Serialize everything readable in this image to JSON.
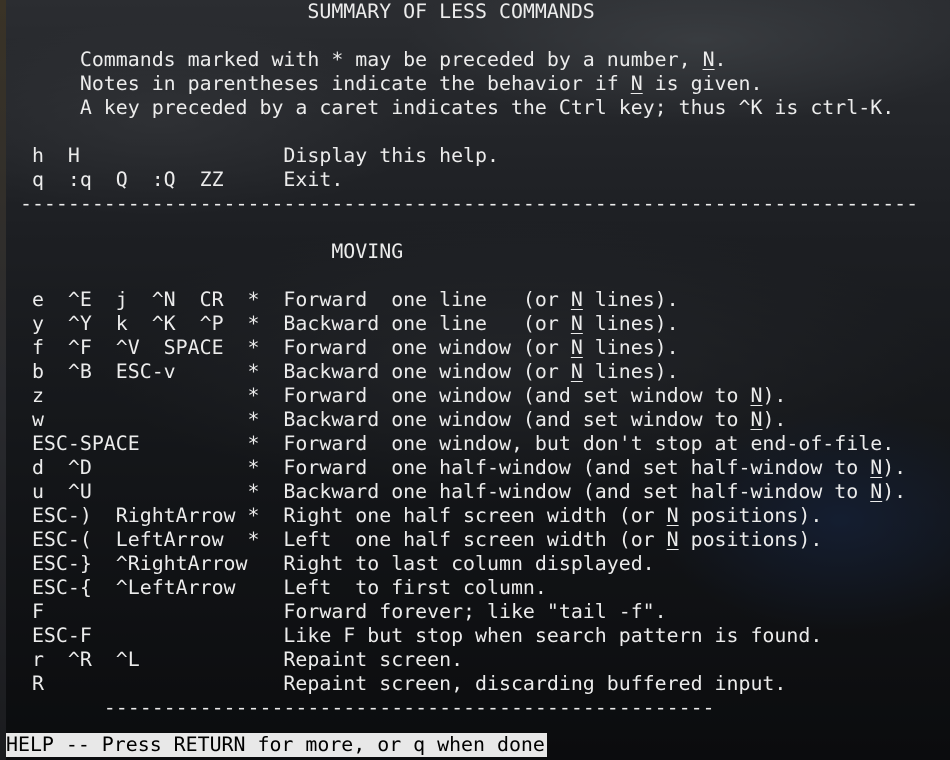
{
  "screen": {
    "title": "                         SUMMARY OF LESS COMMANDS",
    "intro": [
      {
        "segments": [
          {
            "t": "      Commands marked with * may be preceded by a number, ",
            "u": false
          },
          {
            "t": "N",
            "u": true
          },
          {
            "t": ".",
            "u": false
          }
        ]
      },
      {
        "segments": [
          {
            "t": "      Notes in parentheses indicate the behavior if ",
            "u": false
          },
          {
            "t": "N",
            "u": true
          },
          {
            "t": " is given.",
            "u": false
          }
        ]
      },
      {
        "segments": [
          {
            "t": "      A key preceded by a caret indicates the Ctrl key; thus ^K is ctrl-K.",
            "u": false
          }
        ]
      }
    ],
    "basic_commands": [
      {
        "segments": [
          {
            "t": "  h  H                 Display this help.",
            "u": false
          }
        ]
      },
      {
        "segments": [
          {
            "t": "  q  :q  Q  :Q  ZZ     Exit.",
            "u": false
          }
        ]
      }
    ],
    "separator": " ---------------------------------------------------------------------------",
    "section_heading": "                           MOVING",
    "moving_commands": [
      {
        "segments": [
          {
            "t": "  e  ^E  j  ^N  CR  *  Forward  one line   (or ",
            "u": false
          },
          {
            "t": "N",
            "u": true
          },
          {
            "t": " lines).",
            "u": false
          }
        ]
      },
      {
        "segments": [
          {
            "t": "  y  ^Y  k  ^K  ^P  *  Backward one line   (or ",
            "u": false
          },
          {
            "t": "N",
            "u": true
          },
          {
            "t": " lines).",
            "u": false
          }
        ]
      },
      {
        "segments": [
          {
            "t": "  f  ^F  ^V  SPACE  *  Forward  one window (or ",
            "u": false
          },
          {
            "t": "N",
            "u": true
          },
          {
            "t": " lines).",
            "u": false
          }
        ]
      },
      {
        "segments": [
          {
            "t": "  b  ^B  ESC-v      *  Backward one window (or ",
            "u": false
          },
          {
            "t": "N",
            "u": true
          },
          {
            "t": " lines).",
            "u": false
          }
        ]
      },
      {
        "segments": [
          {
            "t": "  z                 *  Forward  one window (and set window to ",
            "u": false
          },
          {
            "t": "N",
            "u": true
          },
          {
            "t": ").",
            "u": false
          }
        ]
      },
      {
        "segments": [
          {
            "t": "  w                 *  Backward one window (and set window to ",
            "u": false
          },
          {
            "t": "N",
            "u": true
          },
          {
            "t": ").",
            "u": false
          }
        ]
      },
      {
        "segments": [
          {
            "t": "  ESC-SPACE         *  Forward  one window, but don't stop at end-of-file.",
            "u": false
          }
        ]
      },
      {
        "segments": [
          {
            "t": "  d  ^D             *  Forward  one half-window (and set half-window to ",
            "u": false
          },
          {
            "t": "N",
            "u": true
          },
          {
            "t": ").",
            "u": false
          }
        ]
      },
      {
        "segments": [
          {
            "t": "  u  ^U             *  Backward one half-window (and set half-window to ",
            "u": false
          },
          {
            "t": "N",
            "u": true
          },
          {
            "t": ").",
            "u": false
          }
        ]
      },
      {
        "segments": [
          {
            "t": "  ESC-)  RightArrow *  Right one half screen width (or ",
            "u": false
          },
          {
            "t": "N",
            "u": true
          },
          {
            "t": " positions).",
            "u": false
          }
        ]
      },
      {
        "segments": [
          {
            "t": "  ESC-(  LeftArrow  *  Left  one half screen width (or ",
            "u": false
          },
          {
            "t": "N",
            "u": true
          },
          {
            "t": " positions).",
            "u": false
          }
        ]
      },
      {
        "segments": [
          {
            "t": "  ESC-}  ^RightArrow   Right to last column displayed.",
            "u": false
          }
        ]
      },
      {
        "segments": [
          {
            "t": "  ESC-{  ^LeftArrow    Left  to first column.",
            "u": false
          }
        ]
      },
      {
        "segments": [
          {
            "t": "  F                    Forward forever; like \"tail -f\".",
            "u": false
          }
        ]
      },
      {
        "segments": [
          {
            "t": "  ESC-F                Like F but stop when search pattern is found.",
            "u": false
          }
        ]
      },
      {
        "segments": [
          {
            "t": "  r  ^R  ^L            Repaint screen.",
            "u": false
          }
        ]
      },
      {
        "segments": [
          {
            "t": "  R                    Repaint screen, discarding buffered input.",
            "u": false
          }
        ]
      }
    ],
    "bottom_separator": "        ---------------------------------------------------"
  },
  "status_prompt": "HELP -- Press RETURN for more, or q when done",
  "colors": {
    "text": "#ececec",
    "prompt_background": "#e8e8e8",
    "prompt_text": "#000000"
  }
}
